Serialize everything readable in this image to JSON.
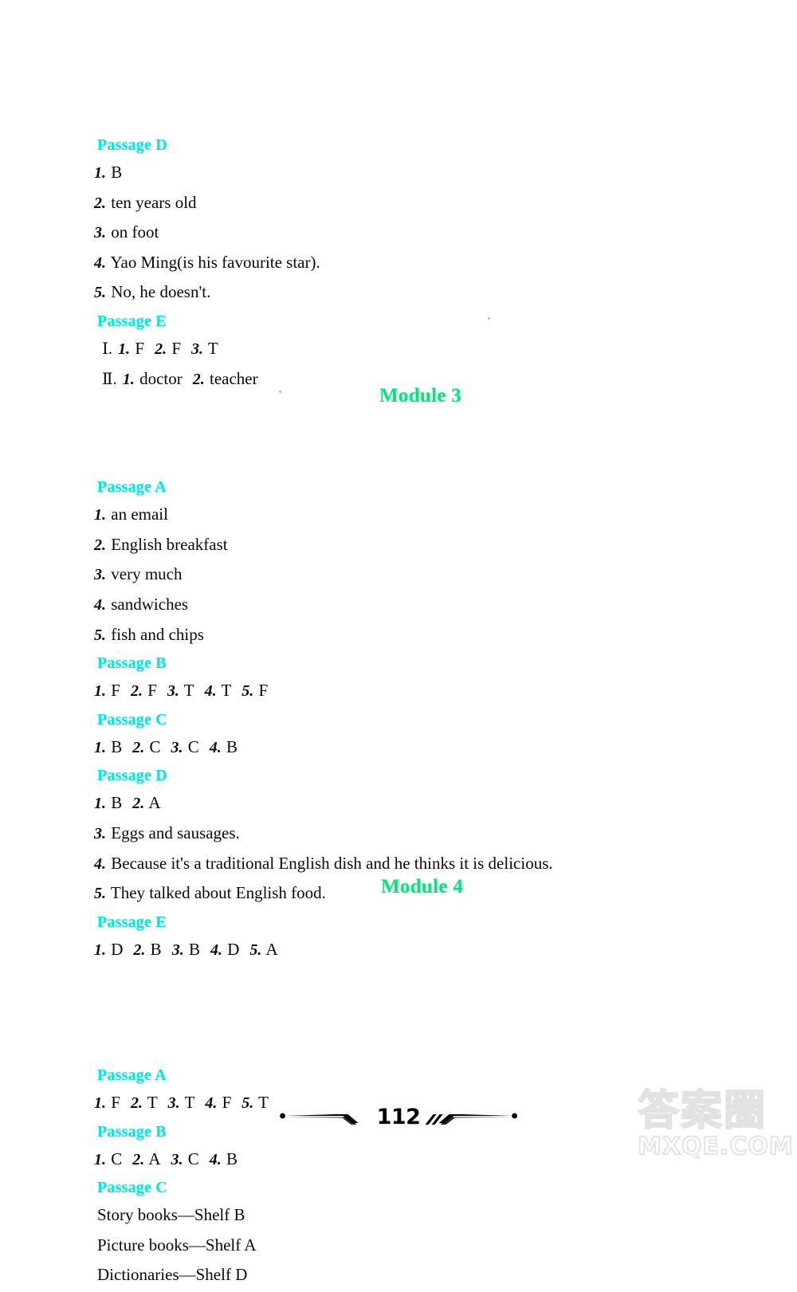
{
  "page": {
    "number": "112",
    "heading_color": "#00e8e0",
    "module_color": "#00e878"
  },
  "watermark": {
    "chinese": "答案圈",
    "latin": "MXQE.COM"
  },
  "sections": [
    {
      "id": "module2-tail",
      "module_title": null,
      "passages": [
        {
          "label": "Passage D",
          "lines": [
            {
              "kind": "numbered",
              "number": "1.",
              "text": "B"
            },
            {
              "kind": "numbered",
              "number": "2.",
              "text": "ten years old"
            },
            {
              "kind": "numbered",
              "number": "3.",
              "text": "on foot"
            },
            {
              "kind": "numbered",
              "number": "4.",
              "text": "Yao Ming(is his favourite star)."
            },
            {
              "kind": "numbered",
              "number": "5.",
              "text": "No, he doesn't."
            }
          ]
        },
        {
          "label": "Passage E",
          "lines": [
            {
              "kind": "roman",
              "roman": "Ⅰ.",
              "items": [
                {
                  "number": "1.",
                  "text": "F"
                },
                {
                  "number": "2.",
                  "text": "F"
                },
                {
                  "number": "3.",
                  "text": "T"
                }
              ]
            },
            {
              "kind": "roman",
              "roman": "Ⅱ.",
              "items": [
                {
                  "number": "1.",
                  "text": "doctor"
                },
                {
                  "number": "2.",
                  "text": "teacher"
                }
              ]
            }
          ]
        }
      ]
    },
    {
      "id": "module3",
      "module_title": "Module 3",
      "passages": [
        {
          "label": "Passage A",
          "lines": [
            {
              "kind": "numbered",
              "number": "1.",
              "text": "an email"
            },
            {
              "kind": "numbered",
              "number": "2.",
              "text": "English breakfast"
            },
            {
              "kind": "numbered",
              "number": "3.",
              "text": "very much"
            },
            {
              "kind": "numbered",
              "number": "4.",
              "text": "sandwiches"
            },
            {
              "kind": "numbered",
              "number": "5.",
              "text": "fish and chips"
            }
          ]
        },
        {
          "label": "Passage B",
          "lines": [
            {
              "kind": "inline",
              "items": [
                {
                  "number": "1.",
                  "text": "F"
                },
                {
                  "number": "2.",
                  "text": "F"
                },
                {
                  "number": "3.",
                  "text": "T"
                },
                {
                  "number": "4.",
                  "text": "T"
                },
                {
                  "number": "5.",
                  "text": "F"
                }
              ]
            }
          ]
        },
        {
          "label": "Passage C",
          "lines": [
            {
              "kind": "inline",
              "items": [
                {
                  "number": "1.",
                  "text": "B"
                },
                {
                  "number": "2.",
                  "text": "C"
                },
                {
                  "number": "3.",
                  "text": "C"
                },
                {
                  "number": "4.",
                  "text": "B"
                }
              ]
            }
          ]
        },
        {
          "label": "Passage D",
          "lines": [
            {
              "kind": "inline",
              "items": [
                {
                  "number": "1.",
                  "text": "B"
                },
                {
                  "number": "2.",
                  "text": "A"
                }
              ]
            },
            {
              "kind": "numbered",
              "number": "3.",
              "text": "Eggs and sausages."
            },
            {
              "kind": "numbered",
              "number": "4.",
              "text": "Because it's a traditional English dish and he thinks it is delicious."
            },
            {
              "kind": "numbered",
              "number": "5.",
              "text": "They talked about English food."
            }
          ]
        },
        {
          "label": "Passage E",
          "lines": [
            {
              "kind": "inline",
              "items": [
                {
                  "number": "1.",
                  "text": "D"
                },
                {
                  "number": "2.",
                  "text": "B"
                },
                {
                  "number": "3.",
                  "text": "B"
                },
                {
                  "number": "4.",
                  "text": "D"
                },
                {
                  "number": "5.",
                  "text": "A"
                }
              ]
            }
          ]
        }
      ]
    },
    {
      "id": "module4",
      "module_title": "Module 4",
      "passages": [
        {
          "label": "Passage A",
          "lines": [
            {
              "kind": "inline",
              "items": [
                {
                  "number": "1.",
                  "text": "F"
                },
                {
                  "number": "2.",
                  "text": "T"
                },
                {
                  "number": "3.",
                  "text": "T"
                },
                {
                  "number": "4.",
                  "text": "F"
                },
                {
                  "number": "5.",
                  "text": "T"
                }
              ]
            }
          ]
        },
        {
          "label": "Passage B",
          "lines": [
            {
              "kind": "inline",
              "items": [
                {
                  "number": "1.",
                  "text": "C"
                },
                {
                  "number": "2.",
                  "text": "A"
                },
                {
                  "number": "3.",
                  "text": "C"
                },
                {
                  "number": "4.",
                  "text": "B"
                }
              ]
            }
          ]
        },
        {
          "label": "Passage C",
          "lines": [
            {
              "kind": "plain",
              "text": "Story books—Shelf B"
            },
            {
              "kind": "plain",
              "text": "Picture books—Shelf A"
            },
            {
              "kind": "plain",
              "text": "Dictionaries—Shelf D"
            }
          ]
        }
      ]
    }
  ]
}
